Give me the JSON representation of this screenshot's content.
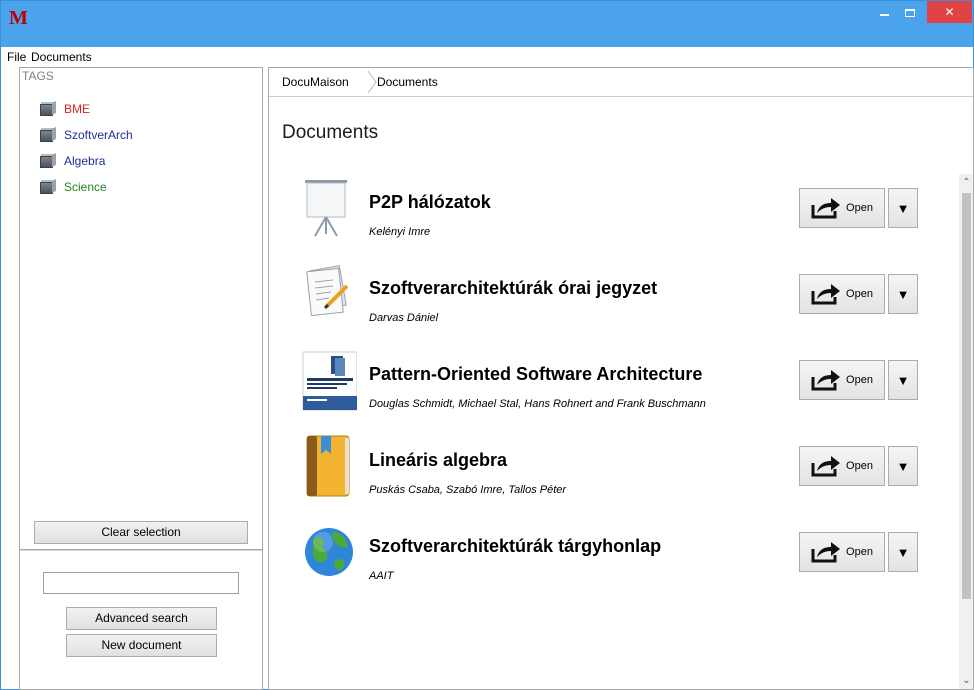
{
  "window": {
    "logo": "M",
    "colors": {
      "titlebar": "#4aa3eb",
      "close": "#e04343",
      "logo": "#c00000"
    }
  },
  "menu": {
    "items": [
      "File",
      "Documents"
    ]
  },
  "tags": {
    "header": "TAGS",
    "items": [
      {
        "label": "BME",
        "color": "#e0201a"
      },
      {
        "label": "SzoftverArch",
        "color": "#1f2f9c"
      },
      {
        "label": "Algebra",
        "color": "#1f2f9c"
      },
      {
        "label": "Science",
        "color": "#1e8a1e"
      }
    ]
  },
  "sidebar": {
    "clear_label": "Clear selection",
    "search_value": "",
    "advanced_search_label": "Advanced search",
    "new_document_label": "New document"
  },
  "breadcrumb": {
    "items": [
      "DocuMaison",
      "Documents"
    ]
  },
  "main": {
    "title": "Documents",
    "open_label": "Open",
    "dropdown_glyph": "▼",
    "documents": [
      {
        "title": "P2P hálózatok",
        "author": "Kelényi Imre",
        "icon": "presentation-icon"
      },
      {
        "title": "Szoftverarchitektúrák órai jegyzet",
        "author": "Darvas Dániel",
        "icon": "notes-icon"
      },
      {
        "title": "Pattern-Oriented Software Architecture",
        "author": "Douglas Schmidt, Michael Stal, Hans Rohnert and Frank Buschmann",
        "icon": "book-cover-icon"
      },
      {
        "title": "Lineáris algebra",
        "author": "Puskás Csaba, Szabó Imre, Tallos Péter",
        "icon": "book-icon"
      },
      {
        "title": "Szoftverarchitektúrák tárgyhonlap",
        "author": "AAIT",
        "icon": "globe-icon"
      }
    ]
  }
}
